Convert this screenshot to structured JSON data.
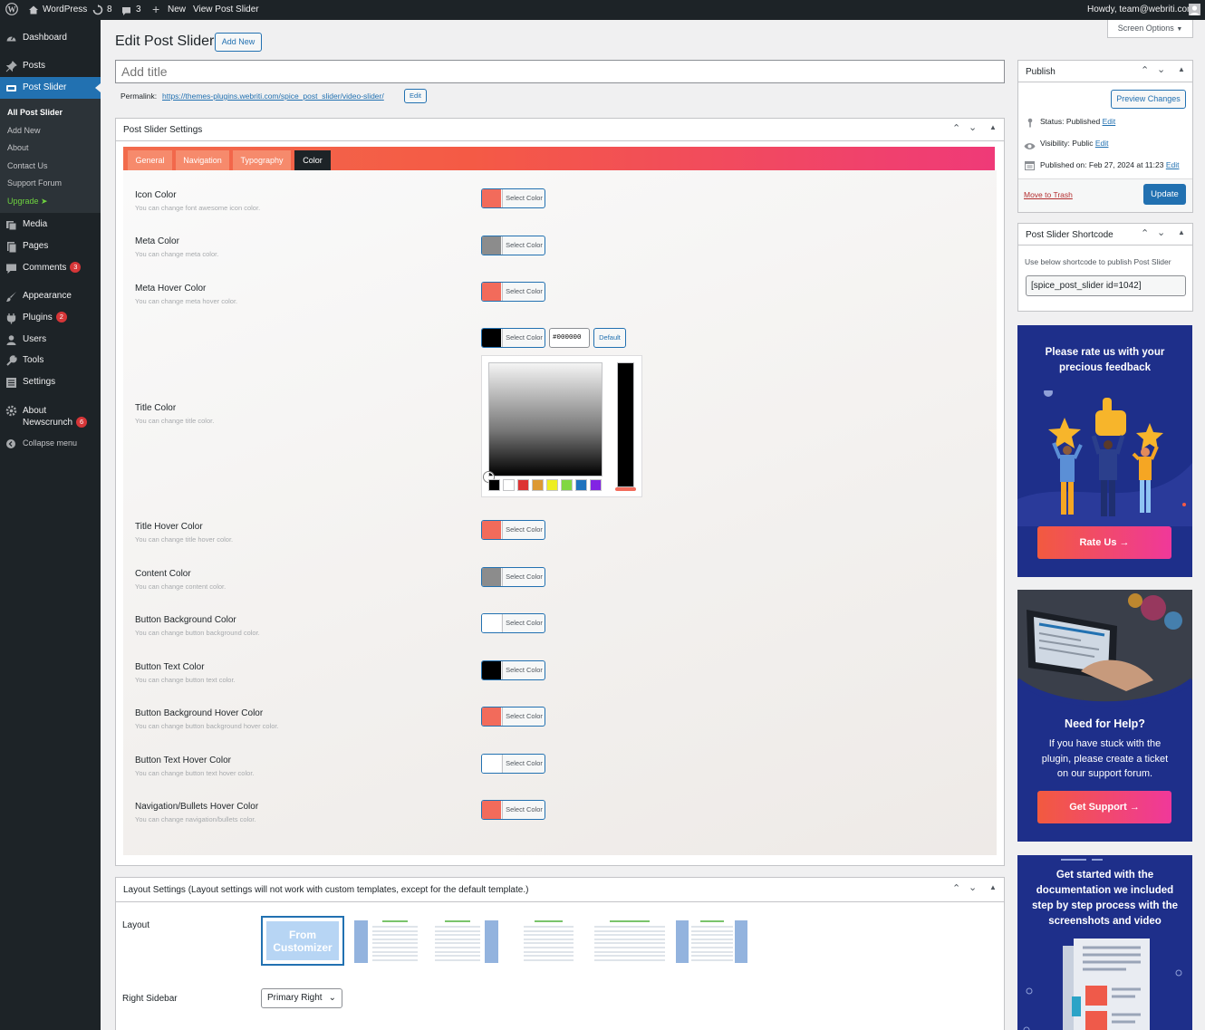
{
  "adminbar": {
    "site": "WordPress",
    "updates": "8",
    "comments": "3",
    "new": "New",
    "view": "View Post Slider",
    "howdy": "Howdy, team@webriti.com"
  },
  "sidebar": {
    "dashboard": "Dashboard",
    "posts": "Posts",
    "post_slider": "Post Slider",
    "submenu": [
      "All Post Slider",
      "Add New",
      "About",
      "Contact Us",
      "Support Forum",
      "Upgrade"
    ],
    "media": "Media",
    "pages": "Pages",
    "comments": "Comments",
    "comments_badge": "3",
    "appearance": "Appearance",
    "plugins": "Plugins",
    "plugins_badge": "2",
    "users": "Users",
    "tools": "Tools",
    "settings": "Settings",
    "about_line1": "About",
    "about_line2": "Newscrunch",
    "about_badge": "6",
    "collapse": "Collapse menu"
  },
  "header": {
    "title": "Edit Post Slider",
    "add_new": "Add New",
    "screen_options": "Screen Options"
  },
  "title_input": {
    "placeholder": "Add title"
  },
  "permalink": {
    "label": "Permalink:",
    "url_base": "https://themes-plugins.webriti.com/spice_post_slider/",
    "url_slug": "video-slider",
    "url_end": "/",
    "edit": "Edit"
  },
  "settings_box": {
    "title": "Post Slider Settings",
    "tabs": [
      "General",
      "Navigation",
      "Typography",
      "Color"
    ],
    "select_color": "Select Color",
    "hex_value": "#000000",
    "default_label": "Default",
    "rows": [
      {
        "label": "Icon Color",
        "desc": "You can change font awesome icon color.",
        "color": "#f26b5b"
      },
      {
        "label": "Meta Color",
        "desc": "You can change meta color.",
        "color": "#8c8c8c"
      },
      {
        "label": "Meta Hover Color",
        "desc": "You can change meta hover color.",
        "color": "#f26b5b"
      },
      {
        "label": "Title Color",
        "desc": "You can change title color.",
        "color": "#000000"
      },
      {
        "label": "Title Hover Color",
        "desc": "You can change title hover color.",
        "color": "#f26b5b"
      },
      {
        "label": "Content Color",
        "desc": "You can change content color.",
        "color": "#8c8c8c"
      },
      {
        "label": "Button Background Color",
        "desc": "You can change button background color.",
        "color": "#ffffff"
      },
      {
        "label": "Button Text Color",
        "desc": "You can change button text color.",
        "color": "#000000"
      },
      {
        "label": "Button Background Hover Color",
        "desc": "You can change button background hover color.",
        "color": "#f26b5b"
      },
      {
        "label": "Button Text Hover Color",
        "desc": "You can change button text hover color.",
        "color": "#ffffff"
      },
      {
        "label": "Navigation/Bullets Hover Color",
        "desc": "You can change navigation/bullets color.",
        "color": "#f26b5b"
      }
    ],
    "palette": [
      "#000000",
      "#ffffff",
      "#dd3333",
      "#dd9933",
      "#eeee22",
      "#81d742",
      "#1e73be",
      "#8224e3"
    ]
  },
  "layout_box": {
    "title": "Layout Settings (Layout settings will not work with custom templates, except for the default template.)",
    "layout_label": "Layout",
    "customizer_line1": "From",
    "customizer_line2": "Customizer",
    "right_sidebar_label": "Right Sidebar",
    "right_sidebar_value": "Primary Right"
  },
  "publish": {
    "title": "Publish",
    "preview": "Preview Changes",
    "status_label": "Status:",
    "status_value": "Published",
    "visibility_label": "Visibility:",
    "visibility_value": "Public",
    "published_label": "Published on:",
    "published_value": "Feb 27, 2024 at 11:23",
    "edit": "Edit",
    "trash": "Move to Trash",
    "update": "Update"
  },
  "shortcode": {
    "title": "Post Slider Shortcode",
    "desc": "Use below shortcode to publish Post Slider",
    "value": "[spice_post_slider id=1042]"
  },
  "ads": {
    "rate_line1": "Please rate us with your",
    "rate_line2": "precious feedback",
    "rate_button": "Rate Us",
    "help_title": "Need for Help?",
    "help_line1": "If you have stuck with the",
    "help_line2": "plugin, please create a ticket",
    "help_line3": "on our support forum.",
    "help_button": "Get Support",
    "doc_line1": "Get started with the",
    "doc_line2": "documentation we included",
    "doc_line3": "step by step process with the",
    "doc_line4": "screenshots and video"
  },
  "colors": {
    "accent": "#2271b1",
    "brand_gradient_start": "#f25a3f",
    "brand_gradient_end": "#f0389a",
    "admin_dark": "#1d2327"
  }
}
